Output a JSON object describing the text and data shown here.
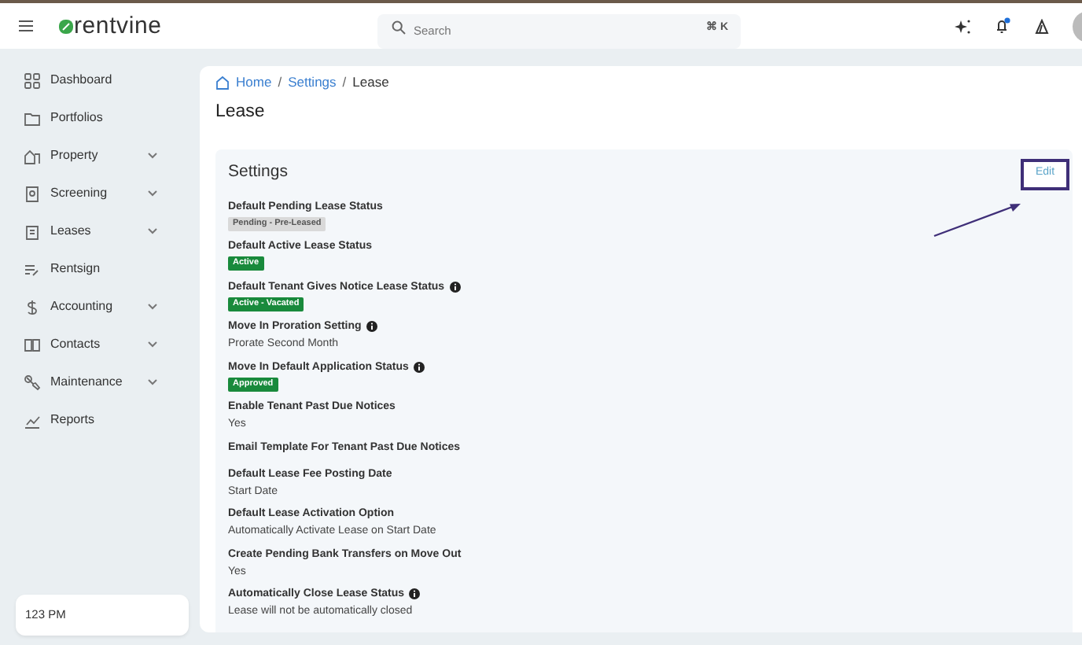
{
  "header": {
    "logo_text": "rentvine",
    "search": {
      "placeholder": "Search",
      "shortcut": "⌘ K"
    },
    "notifications": {
      "unread": true
    }
  },
  "sidebar": {
    "items": [
      {
        "label": "Dashboard",
        "expandable": false
      },
      {
        "label": "Portfolios",
        "expandable": false
      },
      {
        "label": "Property",
        "expandable": true
      },
      {
        "label": "Screening",
        "expandable": true
      },
      {
        "label": "Leases",
        "expandable": true
      },
      {
        "label": "Rentsign",
        "expandable": false
      },
      {
        "label": "Accounting",
        "expandable": true
      },
      {
        "label": "Contacts",
        "expandable": true
      },
      {
        "label": "Maintenance",
        "expandable": true
      },
      {
        "label": "Reports",
        "expandable": false
      }
    ],
    "footer": "123 PM"
  },
  "breadcrumb": {
    "separator": "/",
    "items": [
      "Home",
      "Settings",
      "Lease"
    ]
  },
  "page_title": "Lease",
  "card": {
    "title": "Settings",
    "edit_button": "Edit",
    "settings": [
      {
        "label": "Default Pending Lease Status",
        "info": false,
        "kind": "badge",
        "value": "Pending - Pre-Leased",
        "color": "#d9d9d9"
      },
      {
        "label": "Default Active Lease Status",
        "info": false,
        "kind": "badge",
        "value": "Active",
        "color": "#198a3c"
      },
      {
        "label": "Default Tenant Gives Notice Lease Status",
        "info": true,
        "kind": "badge",
        "value": "Active - Vacated",
        "color": "#198a3c"
      },
      {
        "label": "Move In Proration Setting",
        "info": true,
        "kind": "text",
        "value": "Prorate Second Month"
      },
      {
        "label": "Move In Default Application Status",
        "info": true,
        "kind": "badge",
        "value": "Approved",
        "color": "#198a3c"
      },
      {
        "label": "Enable Tenant Past Due Notices",
        "info": false,
        "kind": "text",
        "value": "Yes"
      },
      {
        "label": "Email Template For Tenant Past Due Notices",
        "info": false,
        "kind": "none"
      },
      {
        "label": "Default Lease Fee Posting Date",
        "info": false,
        "kind": "text",
        "value": "Start Date"
      },
      {
        "label": "Default Lease Activation Option",
        "info": false,
        "kind": "text",
        "value": "Automatically Activate Lease on Start Date"
      },
      {
        "label": "Create Pending Bank Transfers on Move Out",
        "info": false,
        "kind": "text",
        "value": "Yes"
      },
      {
        "label": "Automatically Close Lease Status",
        "info": true,
        "kind": "text",
        "value": "Lease will not be automatically closed"
      }
    ]
  }
}
